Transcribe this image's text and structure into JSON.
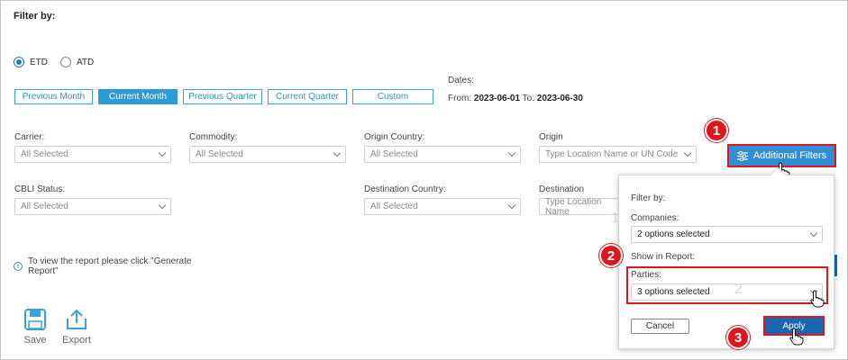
{
  "filter_title": "Filter by:",
  "date_type": {
    "options": [
      {
        "label": "ETD",
        "selected": true
      },
      {
        "label": "ATD",
        "selected": false
      }
    ]
  },
  "periods": [
    {
      "label": "Previous Month",
      "active": false
    },
    {
      "label": "Current Month",
      "active": true
    },
    {
      "label": "Previous Quarter",
      "active": false
    },
    {
      "label": "Current Quarter",
      "active": false
    },
    {
      "label": "Custom",
      "active": false
    }
  ],
  "dates": {
    "label": "Dates:",
    "from_label": "From:",
    "from": "2023-06-01",
    "to_label": "To:",
    "to": "2023-06-30"
  },
  "filters": {
    "carrier": {
      "label": "Carrier:",
      "value": "All Selected"
    },
    "commodity": {
      "label": "Commodity:",
      "value": "All Selected"
    },
    "origin_country": {
      "label": "Origin Country:",
      "value": "All Selected"
    },
    "origin": {
      "label": "Origin",
      "placeholder": "Type Location Name or UN Code"
    },
    "cbli_status": {
      "label": "CBLI Status:",
      "value": "All Selected"
    },
    "destination_country": {
      "label": "Destination Country:",
      "value": "All Selected"
    },
    "destination": {
      "label": "Destination",
      "placeholder": "Type Location Name"
    }
  },
  "info_text_line1": "To view the report please click \"Generate",
  "info_text_line2": "Report\"",
  "tools": {
    "save": "Save",
    "export": "Export"
  },
  "additional_filters_label": "Additional Filters",
  "popup": {
    "filter_title": "Filter by:",
    "companies_label": "Companies:",
    "companies_value": "2 options selected",
    "show_in_report": "Show in Report:",
    "parties_label": "Parties:",
    "parties_value": "3 options selected",
    "cancel": "Cancel",
    "apply": "Apply"
  },
  "badges": [
    "1",
    "2",
    "3"
  ],
  "ghost_numbers": [
    "1",
    "2"
  ],
  "colors": {
    "accent": "#2f8fd6",
    "highlight": "#e0161d",
    "apply": "#1a66b3"
  }
}
